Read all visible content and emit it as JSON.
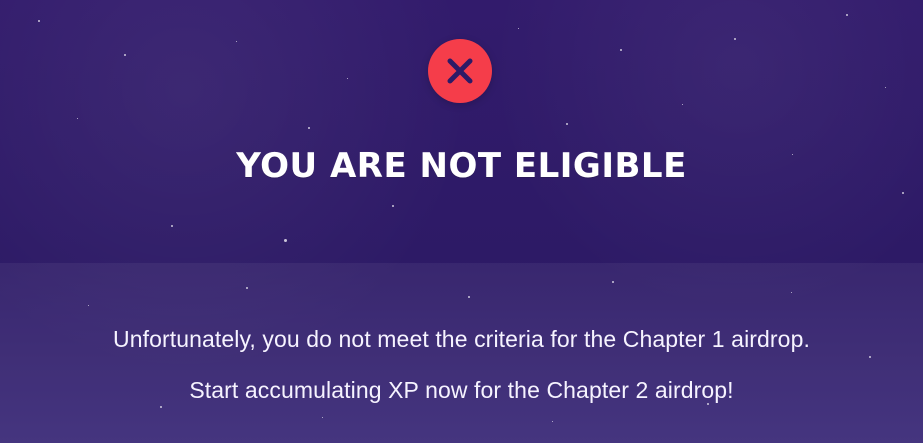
{
  "status": {
    "icon": "close-icon"
  },
  "title": "YOU ARE NOT ELIGIBLE",
  "messages": {
    "line_1": "Unfortunately, you do not meet the criteria for the Chapter 1 airdrop.",
    "line_2": "Start accumulating XP now for the Chapter 2 airdrop!"
  },
  "colors": {
    "background": "#2f1c6a",
    "badge": "#f53d4a",
    "icon": "#2d1a66",
    "text": "#ffffff"
  }
}
